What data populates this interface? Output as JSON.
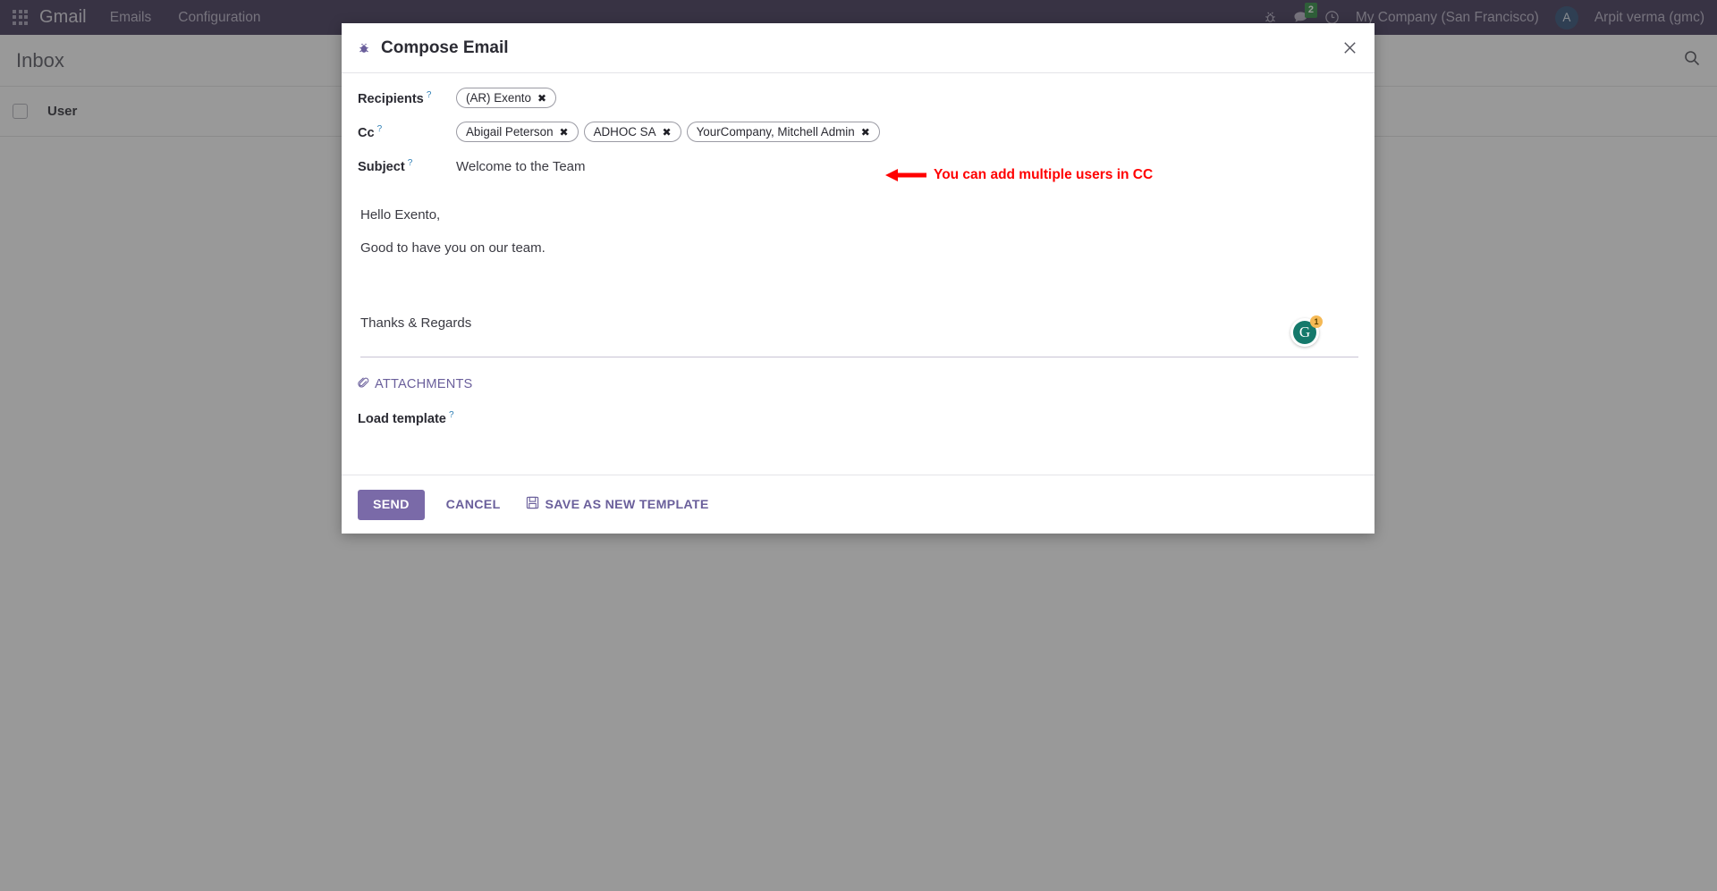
{
  "navbar": {
    "apps_icon": "apps-grid-icon",
    "brand": "Gmail",
    "links": [
      {
        "label": "Emails"
      },
      {
        "label": "Configuration"
      }
    ],
    "bug_icon": "bug-icon",
    "messages_icon": "chat-bubble-icon",
    "messages_count": "2",
    "activity_icon": "clock-icon",
    "company": "My Company (San Francisco)",
    "avatar_initial": "A",
    "user": "Arpit verma (gmc)"
  },
  "control_panel": {
    "breadcrumb": "Inbox",
    "search_icon": "search-icon"
  },
  "list": {
    "columns": [
      {
        "label": "User"
      }
    ]
  },
  "modal": {
    "title": "Compose Email",
    "title_icon": "bug-icon",
    "close_icon": "close-icon",
    "fields": {
      "recipients": {
        "label": "Recipients",
        "help": "?",
        "tags": [
          {
            "label": "(AR) Exento",
            "remove": "✖"
          }
        ]
      },
      "cc": {
        "label": "Cc",
        "help": "?",
        "tags": [
          {
            "label": "Abigail Peterson",
            "remove": "✖"
          },
          {
            "label": "ADHOC SA",
            "remove": "✖"
          },
          {
            "label": "YourCompany, Mitchell Admin",
            "remove": "✖"
          }
        ]
      },
      "subject": {
        "label": "Subject",
        "help": "?",
        "value": "Welcome to the Team"
      },
      "load_template": {
        "label": "Load template",
        "help": "?",
        "value": ""
      }
    },
    "body": {
      "line1": "Hello Exento,",
      "line2": "Good to have you on our team.",
      "line3": "Thanks & Regards"
    },
    "grammarly": {
      "letter": "G",
      "count": "1"
    },
    "attachments": {
      "label": "ATTACHMENTS",
      "icon": "paperclip-icon"
    },
    "footer": {
      "send": "SEND",
      "cancel": "CANCEL",
      "save_template": "SAVE AS NEW TEMPLATE",
      "save_icon": "floppy-disk-icon"
    }
  },
  "annotation": {
    "text": "You can add multiple users in CC",
    "color": "#ff0000",
    "arrow": "left-arrow-icon"
  },
  "colors": {
    "navbar_bg": "#3c3254",
    "accent_purple": "#7a6aa8",
    "link_purple": "#6a5f9b",
    "badge_green": "#2b8a3e",
    "annotation_red": "#ff0000",
    "grammarly_green": "#15796b"
  }
}
